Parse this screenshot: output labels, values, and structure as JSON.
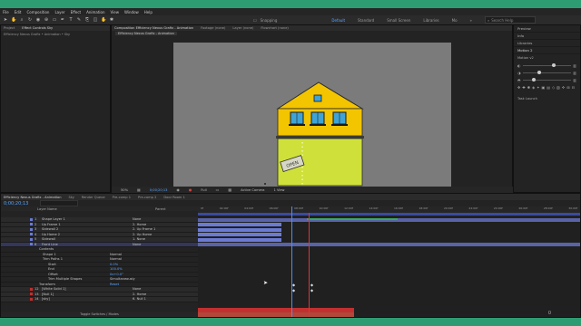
{
  "menu": [
    "File",
    "Edit",
    "Composition",
    "Layer",
    "Effect",
    "Animation",
    "View",
    "Window",
    "Help"
  ],
  "toolbar": {
    "snapping": "Snapping",
    "workspaces": [
      "Default",
      "Standard",
      "Small Screen",
      "Libraries",
      "Mo"
    ],
    "active_workspace": "Default",
    "search_placeholder": "Search Help"
  },
  "project_panel": {
    "tabs": [
      "Project",
      "Effect Controls Sky"
    ],
    "subtitle": "Efficiency Nexus Grafix • Animation • Sky"
  },
  "comp_panel": {
    "tabs": [
      "Composition Efficiency Nexus Grafix - Animation",
      "Footage (none)",
      "Layer (none)",
      "Flowchart (none)"
    ],
    "comp_tab": "Efficiency Nexus Grafix - Animation",
    "sign_text": "OPEN",
    "footer": {
      "zoom": "50%",
      "timecode": "0;00;20;13",
      "quality": "Full",
      "camera": "Active Camera",
      "views": "1 View"
    }
  },
  "right_panel": {
    "items": [
      "Preview",
      "Info",
      "Libraries",
      "Motion 2"
    ],
    "motion_label": "Motion v2",
    "task_launcher": "Task Launch"
  },
  "timeline": {
    "tabs": [
      "Efficiency Nexus Grafix - Animation",
      "Sky",
      "Render Queue",
      "Pre-comp 1",
      "Pre-comp 2",
      "Door Room 1"
    ],
    "timecode": "0;00;20;13",
    "column_header": "Layer Name",
    "parent_header": "Parent",
    "layers": [
      {
        "num": "1",
        "name": "Shape Layer 1",
        "parent": "None"
      },
      {
        "num": "2",
        "name": "Up Frame 1",
        "parent": "2. Home"
      },
      {
        "num": "3",
        "name": "Sidewall 2",
        "parent": "2. Up Frame 1"
      },
      {
        "num": "4",
        "name": "Up Home 2",
        "parent": "2. Up Home"
      },
      {
        "num": "5",
        "name": "Sidewall",
        "parent": "1. None"
      },
      {
        "num": "6",
        "name": "Front Line",
        "parent": "None"
      }
    ],
    "props": [
      {
        "name": "Contents",
        "value": ""
      },
      {
        "name": "Shape 1",
        "value": "Normal"
      },
      {
        "name": "Trim Paths 1",
        "value": "Normal"
      },
      {
        "name": "Start",
        "value": "0.0%"
      },
      {
        "name": "End",
        "value": "100.0%"
      },
      {
        "name": "Offset",
        "value": "0x+0.0°"
      },
      {
        "name": "Trim Multiple Shapes",
        "value": "Simultaneously"
      },
      {
        "name": "Transform",
        "value": "Reset"
      }
    ],
    "bottom_layers": [
      {
        "num": "12",
        "name": "[White Solid 1]",
        "parent": "None"
      },
      {
        "num": "13",
        "name": "[Null 1]",
        "parent": "2. Home"
      },
      {
        "num": "14",
        "name": "[sky]",
        "parent": "6. Null 1"
      }
    ],
    "ruler_ticks": [
      "0f",
      "02:00f",
      "04:00f",
      "06:00f",
      "08:00f",
      "10:00f",
      "12:00f",
      "14:00f",
      "16:00f",
      "18:00f",
      "20:00f",
      "22:00f",
      "24:00f",
      "26:00f",
      "28:00f",
      "30:00f"
    ],
    "footer": "Toggle Switches / Modes"
  },
  "colors": {
    "accent": "#2e9c72",
    "house_wall": "#cfe03a",
    "house_roof": "#f3c400",
    "timeline_bar": "#6b7bd1",
    "red_bar": "#c0302f"
  }
}
